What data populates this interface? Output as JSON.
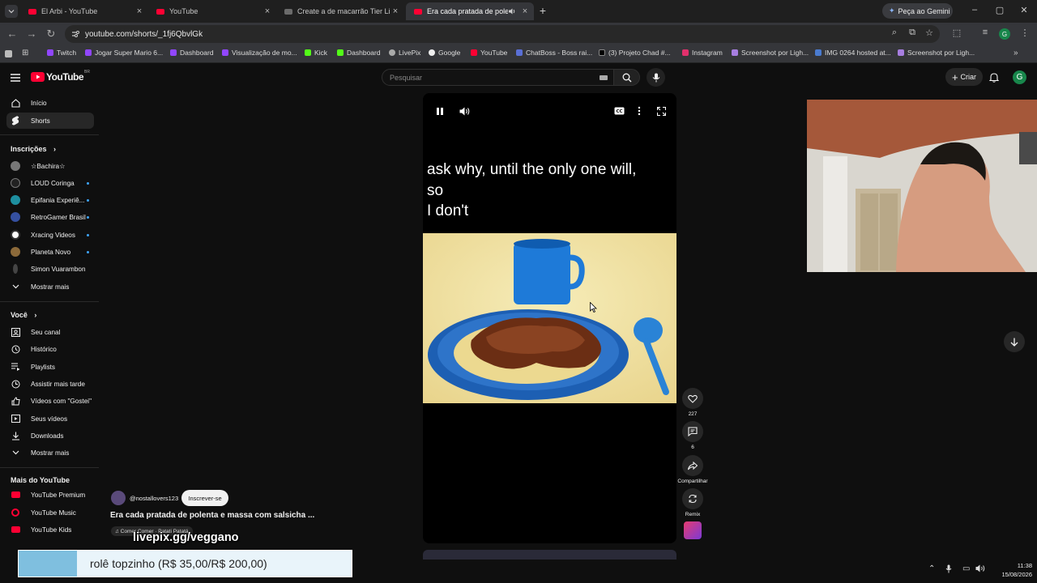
{
  "browser": {
    "tabs": [
      {
        "title": "El Arbi - YouTube",
        "active": false
      },
      {
        "title": "YouTube",
        "active": false
      },
      {
        "title": "Create a de macarrão Tier List",
        "active": false
      },
      {
        "title": "Era cada pratada de polenta",
        "active": true
      }
    ],
    "gemini_label": "Peça ao Gemini",
    "url": "youtube.com/shorts/_1fj6QbvlGk",
    "bookmarks": [
      "Twitch",
      "Jogar Super Mario 6...",
      "Dashboard",
      "Visualização de mo...",
      "Kick",
      "Dashboard",
      "LivePix",
      "Google",
      "YouTube",
      "ChatBoss - Boss rai...",
      "(3) Projeto Chad #...",
      "Instagram",
      "Screenshot por Ligh...",
      "IMG 0264 hosted at...",
      "Screenshot por Ligh..."
    ]
  },
  "youtube": {
    "logo_text": "YouTube",
    "logo_country": "BR",
    "search_placeholder": "Pesquisar",
    "create_label": "Criar",
    "avatar_letter": "G"
  },
  "sidebar": {
    "main": [
      {
        "label": "Início",
        "icon": "home-icon"
      },
      {
        "label": "Shorts",
        "icon": "shorts-icon",
        "active": true
      }
    ],
    "subscriptions_header": "Inscrições",
    "subscriptions": [
      {
        "label": "☆Bachira☆",
        "dot": false
      },
      {
        "label": "LOUD Coringa",
        "dot": true
      },
      {
        "label": "Epifania Experiê...",
        "dot": true
      },
      {
        "label": "RetroGamer Brasil",
        "dot": true
      },
      {
        "label": "Xracing Videos",
        "dot": true
      },
      {
        "label": "Planeta Novo",
        "dot": true
      },
      {
        "label": "Simon Vuarambon",
        "dot": false
      }
    ],
    "show_more_1": "Mostrar mais",
    "you_header": "Você",
    "you_items": [
      {
        "label": "Seu canal",
        "icon": "channel-icon"
      },
      {
        "label": "Histórico",
        "icon": "history-icon"
      },
      {
        "label": "Playlists",
        "icon": "playlist-icon"
      },
      {
        "label": "Assistir mais tarde",
        "icon": "clock-icon"
      },
      {
        "label": "Vídeos com \"Gostei\"",
        "icon": "like-icon"
      },
      {
        "label": "Seus vídeos",
        "icon": "video-icon"
      },
      {
        "label": "Downloads",
        "icon": "download-icon"
      }
    ],
    "show_more_2": "Mostrar mais",
    "more_header": "Mais do YouTube",
    "more_items": [
      {
        "label": "YouTube Premium"
      },
      {
        "label": "YouTube Music"
      },
      {
        "label": "YouTube Kids"
      }
    ]
  },
  "short": {
    "caption_lines": [
      "ask why, until the only one will,",
      "so",
      "I don't"
    ],
    "likes": "227",
    "comments": "6",
    "share_label": "Compartilhar",
    "remix_label": "Remix",
    "channel": "@nostallovers123",
    "subscribe_label": "Inscrever-se",
    "title": "Era cada pratada de polenta e massa com salsicha ...",
    "music": "♫ Comer Comer · Patati Patatá"
  },
  "stream_overlay": {
    "url_text": "livepix.gg/veggano",
    "donation_text": "rolê topzinho (R$ 35,00/R$ 200,00)"
  },
  "taskbar": {
    "time": "11:38",
    "date": "15/08/2026"
  }
}
